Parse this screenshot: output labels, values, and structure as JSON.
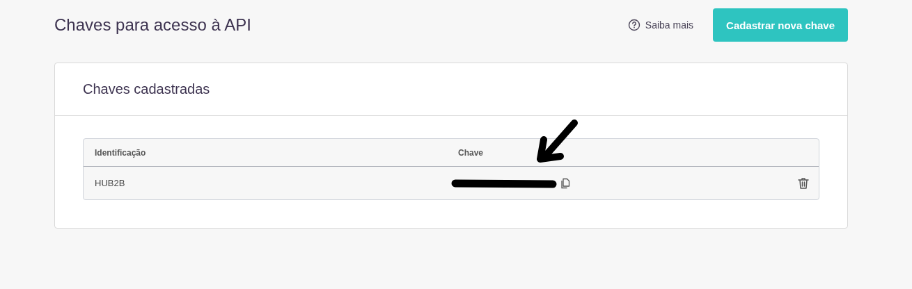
{
  "page_title": "Chaves para acesso à API",
  "help_link": "Saiba mais",
  "primary_button": "Cadastrar nova chave",
  "card": {
    "title": "Chaves cadastradas",
    "table": {
      "columns": [
        "Identificação",
        "Chave"
      ],
      "rows": [
        {
          "identification": "HUB2B"
        }
      ]
    }
  }
}
